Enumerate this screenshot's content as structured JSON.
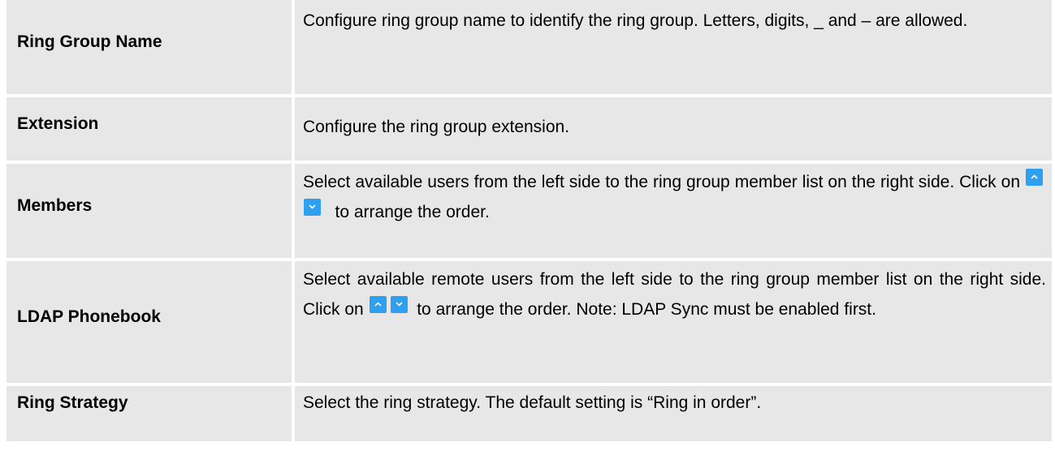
{
  "rows": [
    {
      "label": "Ring Group Name",
      "desc": "Configure ring group name to identify the ring group. Letters, digits, _ and – are allowed."
    },
    {
      "label": "Extension",
      "desc": "Configure the ring group extension."
    },
    {
      "label": "Members",
      "desc_before": "Select available users from the left side to the ring group member list on the right side. Click on",
      "desc_after": "to arrange the order."
    },
    {
      "label": "LDAP Phonebook",
      "desc_before": "Select available remote users from the left side to the ring group member list on the right side. Click on",
      "desc_after": "to arrange the order. Note: LDAP Sync must be enabled first."
    },
    {
      "label": "Ring Strategy",
      "desc": "Select the ring strategy. The default setting is “Ring in order”."
    }
  ],
  "icons": {
    "up": "chevron-up-icon",
    "down": "chevron-down-icon"
  },
  "colors": {
    "cell_background": "#e7e7e7",
    "button_blue": "#2f9ff0"
  }
}
